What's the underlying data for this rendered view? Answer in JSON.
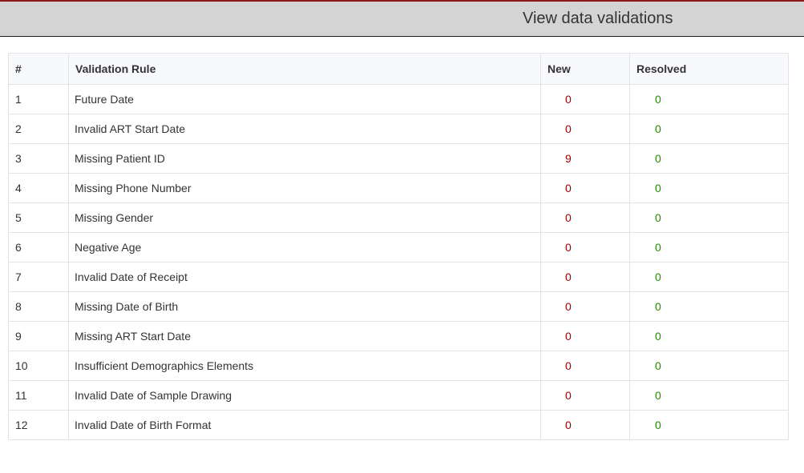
{
  "header": {
    "title": "View data validations"
  },
  "table": {
    "columns": [
      "#",
      "Validation Rule",
      "New",
      "Resolved"
    ],
    "rows": [
      {
        "num": "1",
        "rule": "Future Date",
        "new": "0",
        "resolved": "0"
      },
      {
        "num": "2",
        "rule": "Invalid ART Start Date",
        "new": "0",
        "resolved": "0"
      },
      {
        "num": "3",
        "rule": "Missing Patient ID",
        "new": "9",
        "resolved": "0"
      },
      {
        "num": "4",
        "rule": "Missing Phone Number",
        "new": "0",
        "resolved": "0"
      },
      {
        "num": "5",
        "rule": "Missing Gender",
        "new": "0",
        "resolved": "0"
      },
      {
        "num": "6",
        "rule": "Negative Age",
        "new": "0",
        "resolved": "0"
      },
      {
        "num": "7",
        "rule": "Invalid Date of Receipt",
        "new": "0",
        "resolved": "0"
      },
      {
        "num": "8",
        "rule": "Missing Date of Birth",
        "new": "0",
        "resolved": "0"
      },
      {
        "num": "9",
        "rule": "Missing ART Start Date",
        "new": "0",
        "resolved": "0"
      },
      {
        "num": "10",
        "rule": "Insufficient Demographics Elements",
        "new": "0",
        "resolved": "0"
      },
      {
        "num": "11",
        "rule": "Invalid Date of Sample Drawing",
        "new": "0",
        "resolved": "0"
      },
      {
        "num": "12",
        "rule": "Invalid Date of Birth Format",
        "new": "0",
        "resolved": "0"
      }
    ]
  },
  "colors": {
    "header_accent": "#8b1a1a",
    "new_count": "#a50000",
    "resolved_count": "#238b00"
  }
}
